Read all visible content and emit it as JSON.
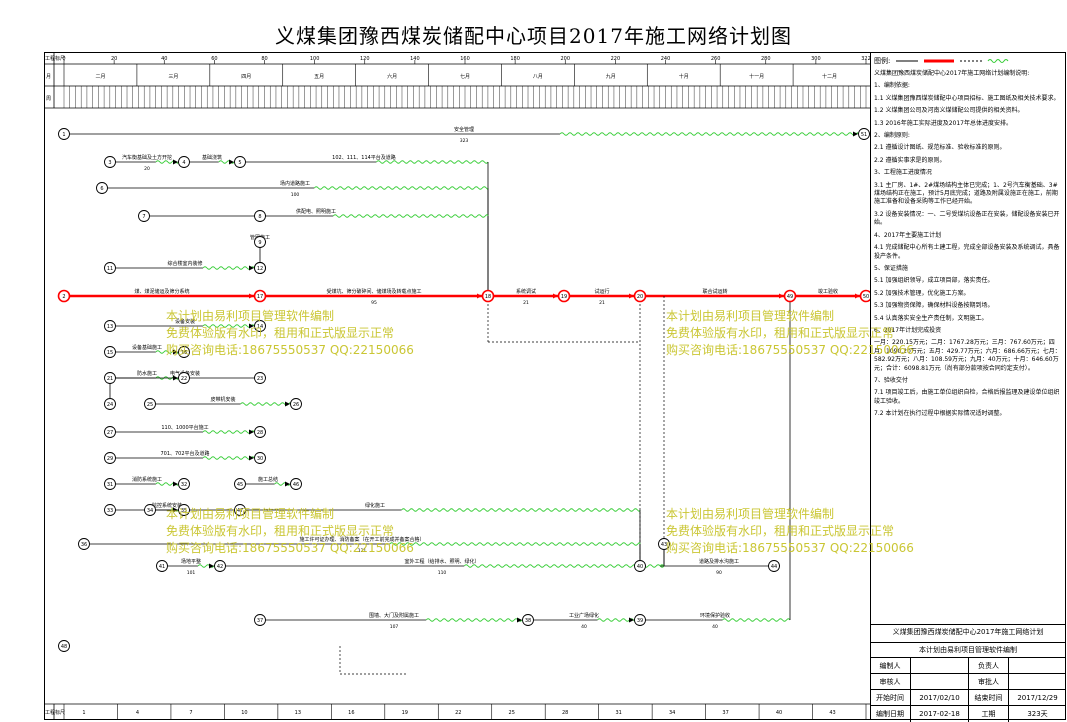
{
  "title": "义煤集团豫西煤炭储配中心项目2017年施工网络计划图",
  "axis": {
    "top_label": "工程标尺",
    "bottom_label": "工程标尺",
    "day_ticks": [
      "0",
      "20",
      "40",
      "60",
      "80",
      "100",
      "120",
      "140",
      "160",
      "180",
      "200",
      "220",
      "240",
      "260",
      "280",
      "300",
      "322"
    ],
    "month_row_label": "月",
    "months": [
      "二月",
      "三月",
      "四月",
      "五月",
      "六月",
      "七月",
      "八月",
      "九月",
      "十月",
      "十一月",
      "十二月"
    ],
    "week_row_label": "周",
    "bottom_ticks": [
      "1",
      "4",
      "7",
      "10",
      "13",
      "16",
      "19",
      "22",
      "25",
      "28",
      "31",
      "34",
      "37",
      "40",
      "43",
      "46"
    ]
  },
  "legend": {
    "label": "图例:",
    "items": [
      {
        "text": "普通工作",
        "color": "#000000"
      },
      {
        "text": "关键工作",
        "color": "#ff0000"
      },
      {
        "text": "虚工作",
        "color": "#000000"
      },
      {
        "text": "自由时差",
        "color": "#33cc33"
      }
    ]
  },
  "notes": [
    "义煤集团豫西煤炭储配中心2017年施工网络计划编制说明:",
    "1、编制依据:",
    "1.1 义煤集团豫西煤炭储配中心项目招标、施工图纸及相关技术要求。",
    "1.2 义煤集团公司及河南义煤储配公司提供的相关资料。",
    "1.3 2016年施工实际进度及2017年总体进度安排。",
    "2、编制原则:",
    "2.1 遵循设计图纸、规范标准、验收标准的原则。",
    "2.2 遵循实事求是的原则。",
    "3、工程施工进度情况",
    "3.1 主厂房、1#、2#煤场结构主体已完成；1、2号汽车衡基础、3#煤场结构正在施工，预计5月底完成；道路及附属设施正在施工，前期施工准备和设备采购等工作已经开始。",
    "3.2 设备安装情况：一、二号受煤坑设备正在安装，储配设备安装已开始。",
    "4、2017年主要施工计划",
    "4.1 完成储配中心所有土建工程，完成全部设备安装及系统调试，具备投产条件。",
    "5、保证措施",
    "5.1 加强组织领导，成立项目部，落实责任。",
    "5.2 加强技术管理，优化施工方案。",
    "5.3 加强物资保障，确保材料设备按期到场。",
    "5.4 认真落实安全生产责任制，文明施工。",
    "6、2017年计划完成投资",
    "一月：220.15万元；二月：1767.28万元；三月：767.60万元；四月：1090.20万元；五月：429.77万元；六月：686.66万元；七月：582.92万元；八月：108.59万元；九月：40万元；十月：646.60万元；合计：6098.81万元（尚有部分款项按合同约定支付）。",
    "7、验收交付",
    "7.1 项目竣工后，由施工单位组织自检，合格后报监理及建设单位组织竣工验收。",
    "7.2 本计划在执行过程中根据实际情况适时调整。"
  ],
  "infobox": {
    "heading": "义煤集团豫西煤炭储配中心2017年施工网络计划",
    "subheading": "本计划由易利项目管理软件编制",
    "rows": [
      {
        "a": "编制人",
        "b": "",
        "c": "负责人",
        "d": ""
      },
      {
        "a": "审核人",
        "b": "",
        "c": "审批人",
        "d": ""
      },
      {
        "a": "开始时间",
        "b": "2017/02/10",
        "c": "结束时间",
        "d": "2017/12/29"
      },
      {
        "a": "编制日期",
        "b": "2017-02-18",
        "c": "工期",
        "d": "323天"
      }
    ]
  },
  "watermarks": [
    [
      "本计划由易利项目管理软件编制",
      "免费体验版有水印，租用和正式版显示正常",
      "购买咨询电话:18675550537 QQ:22150066"
    ],
    [
      "本计划由易利项目管理软件编制",
      "免费体验版有水印，租用和正式版显示正常",
      "购买咨询电话:18675550537 QQ:22150066"
    ],
    [
      "本计划由易利项目管理软件编制",
      "免费体验版有水印，租用和正式版显示正常",
      "购买咨询电话:18675550537 QQ:22150066"
    ],
    [
      "本计划由易利项目管理软件编制",
      "免费体验版有水印，租用和正式版显示正常",
      "购买咨询电话:18675550537 QQ:22150066"
    ]
  ],
  "network": {
    "nodes": [
      {
        "id": "1",
        "label": "1"
      },
      {
        "id": "2",
        "label": "2"
      },
      {
        "id": "3",
        "label": "3"
      },
      {
        "id": "4",
        "label": "4"
      },
      {
        "id": "5",
        "label": "5"
      },
      {
        "id": "6",
        "label": "6"
      },
      {
        "id": "7",
        "label": "7"
      },
      {
        "id": "8",
        "label": "8"
      },
      {
        "id": "9",
        "label": "9"
      },
      {
        "id": "10",
        "label": "10"
      },
      {
        "id": "11",
        "label": "11"
      },
      {
        "id": "12",
        "label": "12"
      },
      {
        "id": "13",
        "label": "13"
      },
      {
        "id": "14",
        "label": "14"
      },
      {
        "id": "15",
        "label": "15"
      },
      {
        "id": "16",
        "label": "16"
      },
      {
        "id": "17",
        "label": "17"
      },
      {
        "id": "18",
        "label": "18"
      },
      {
        "id": "19",
        "label": "19"
      },
      {
        "id": "20",
        "label": "20"
      },
      {
        "id": "21",
        "label": "21"
      },
      {
        "id": "22",
        "label": "22"
      },
      {
        "id": "23",
        "label": "23"
      },
      {
        "id": "24",
        "label": "24"
      },
      {
        "id": "25",
        "label": "25"
      },
      {
        "id": "26",
        "label": "26"
      },
      {
        "id": "27",
        "label": "27"
      },
      {
        "id": "28",
        "label": "28"
      },
      {
        "id": "29",
        "label": "29"
      },
      {
        "id": "30",
        "label": "30"
      },
      {
        "id": "31",
        "label": "31"
      },
      {
        "id": "32",
        "label": "32"
      },
      {
        "id": "33",
        "label": "33"
      },
      {
        "id": "34",
        "label": "34"
      },
      {
        "id": "35",
        "label": "35"
      },
      {
        "id": "36",
        "label": "36"
      },
      {
        "id": "37",
        "label": "37"
      },
      {
        "id": "38",
        "label": "38"
      },
      {
        "id": "39",
        "label": "39"
      },
      {
        "id": "40",
        "label": "40"
      },
      {
        "id": "41",
        "label": "41"
      },
      {
        "id": "42",
        "label": "42"
      },
      {
        "id": "43",
        "label": "43"
      },
      {
        "id": "44",
        "label": "44"
      },
      {
        "id": "45",
        "label": "45"
      },
      {
        "id": "46",
        "label": "46"
      },
      {
        "id": "47",
        "label": "47"
      },
      {
        "id": "48",
        "label": "48"
      },
      {
        "id": "49",
        "label": "49"
      },
      {
        "id": "50",
        "label": "50"
      },
      {
        "id": "51",
        "label": "51"
      }
    ],
    "activities": [
      {
        "from": "1",
        "to": "51",
        "name": "安全管理",
        "dur": "323",
        "type": "normal"
      },
      {
        "from": "2",
        "to": "17",
        "name": "煤、煤泥储运及筛分系统",
        "dur": "",
        "type": "critical"
      },
      {
        "from": "17",
        "to": "18",
        "name": "受煤坑、筛分破碎间、储煤场及转载点施工",
        "dur": "95",
        "type": "critical"
      },
      {
        "from": "18",
        "to": "19",
        "name": "系统调试",
        "dur": "21",
        "type": "critical"
      },
      {
        "from": "19",
        "to": "20",
        "name": "试运行",
        "dur": "21",
        "type": "critical"
      },
      {
        "from": "20",
        "to": "49",
        "name": "联合试运转",
        "dur": "",
        "type": "critical"
      },
      {
        "from": "49",
        "to": "50",
        "name": "竣工验收",
        "dur": "",
        "type": "critical"
      },
      {
        "from": "3",
        "to": "4",
        "name": "汽车衡基础及土方开挖",
        "dur": "20",
        "type": "normal"
      },
      {
        "from": "4",
        "to": "5",
        "name": "基础浇筑",
        "dur": "",
        "type": "normal"
      },
      {
        "from": "5",
        "to": "18",
        "name": "102、111、114平台及道路",
        "dur": "",
        "type": "normal"
      },
      {
        "from": "6",
        "to": "18",
        "name": "场内道路施工",
        "dur": "100",
        "type": "normal"
      },
      {
        "from": "7",
        "to": "18",
        "name": "供配电、照明施工",
        "dur": "",
        "type": "normal"
      },
      {
        "from": "9",
        "to": "10",
        "name": "管网施工",
        "dur": "",
        "type": "normal"
      },
      {
        "from": "11",
        "to": "12",
        "name": "综合楼室内装修",
        "dur": "",
        "type": "normal"
      },
      {
        "from": "13",
        "to": "14",
        "name": "设备安装",
        "dur": "",
        "type": "normal"
      },
      {
        "from": "15",
        "to": "16",
        "name": "设备基础施工",
        "dur": "",
        "type": "normal"
      },
      {
        "from": "21",
        "to": "22",
        "name": "防水施工",
        "dur": "",
        "type": "normal"
      },
      {
        "from": "23",
        "to": "24",
        "name": "电气设备安装",
        "dur": "",
        "type": "normal"
      },
      {
        "from": "25",
        "to": "26",
        "name": "皮带机安装",
        "dur": "",
        "type": "normal"
      },
      {
        "from": "27",
        "to": "28",
        "name": "110、1000平台施工",
        "dur": "",
        "type": "normal"
      },
      {
        "from": "29",
        "to": "30",
        "name": "701、702平台及道路",
        "dur": "",
        "type": "normal"
      },
      {
        "from": "31",
        "to": "32",
        "name": "消防系统施工",
        "dur": "",
        "type": "normal"
      },
      {
        "from": "33",
        "to": "40",
        "name": "绿化施工",
        "dur": "",
        "type": "normal"
      },
      {
        "from": "34",
        "to": "35",
        "name": "监控系统安装",
        "dur": "",
        "type": "normal"
      },
      {
        "from": "36",
        "to": "40",
        "name": "施工许可证办理、消防备案（在开工前完成并备案合格）",
        "dur": "121",
        "type": "normal"
      },
      {
        "from": "37",
        "to": "38",
        "name": "围墙、大门及附属施工",
        "dur": "107",
        "type": "normal"
      },
      {
        "from": "38",
        "to": "39",
        "name": "工业广场绿化",
        "dur": "40",
        "type": "normal"
      },
      {
        "from": "39",
        "to": "49",
        "name": "环境保护验收",
        "dur": "40",
        "type": "normal"
      },
      {
        "from": "41",
        "to": "42",
        "name": "场地平整",
        "dur": "101",
        "type": "normal"
      },
      {
        "from": "42",
        "to": "43",
        "name": "室外工程（给排水、照明、绿化）",
        "dur": "110",
        "type": "normal"
      },
      {
        "from": "44",
        "to": "43",
        "name": "道路及排水沟施工",
        "dur": "90",
        "type": "normal"
      },
      {
        "from": "45",
        "to": "46",
        "name": "施工总结",
        "dur": "",
        "type": "normal"
      }
    ]
  }
}
